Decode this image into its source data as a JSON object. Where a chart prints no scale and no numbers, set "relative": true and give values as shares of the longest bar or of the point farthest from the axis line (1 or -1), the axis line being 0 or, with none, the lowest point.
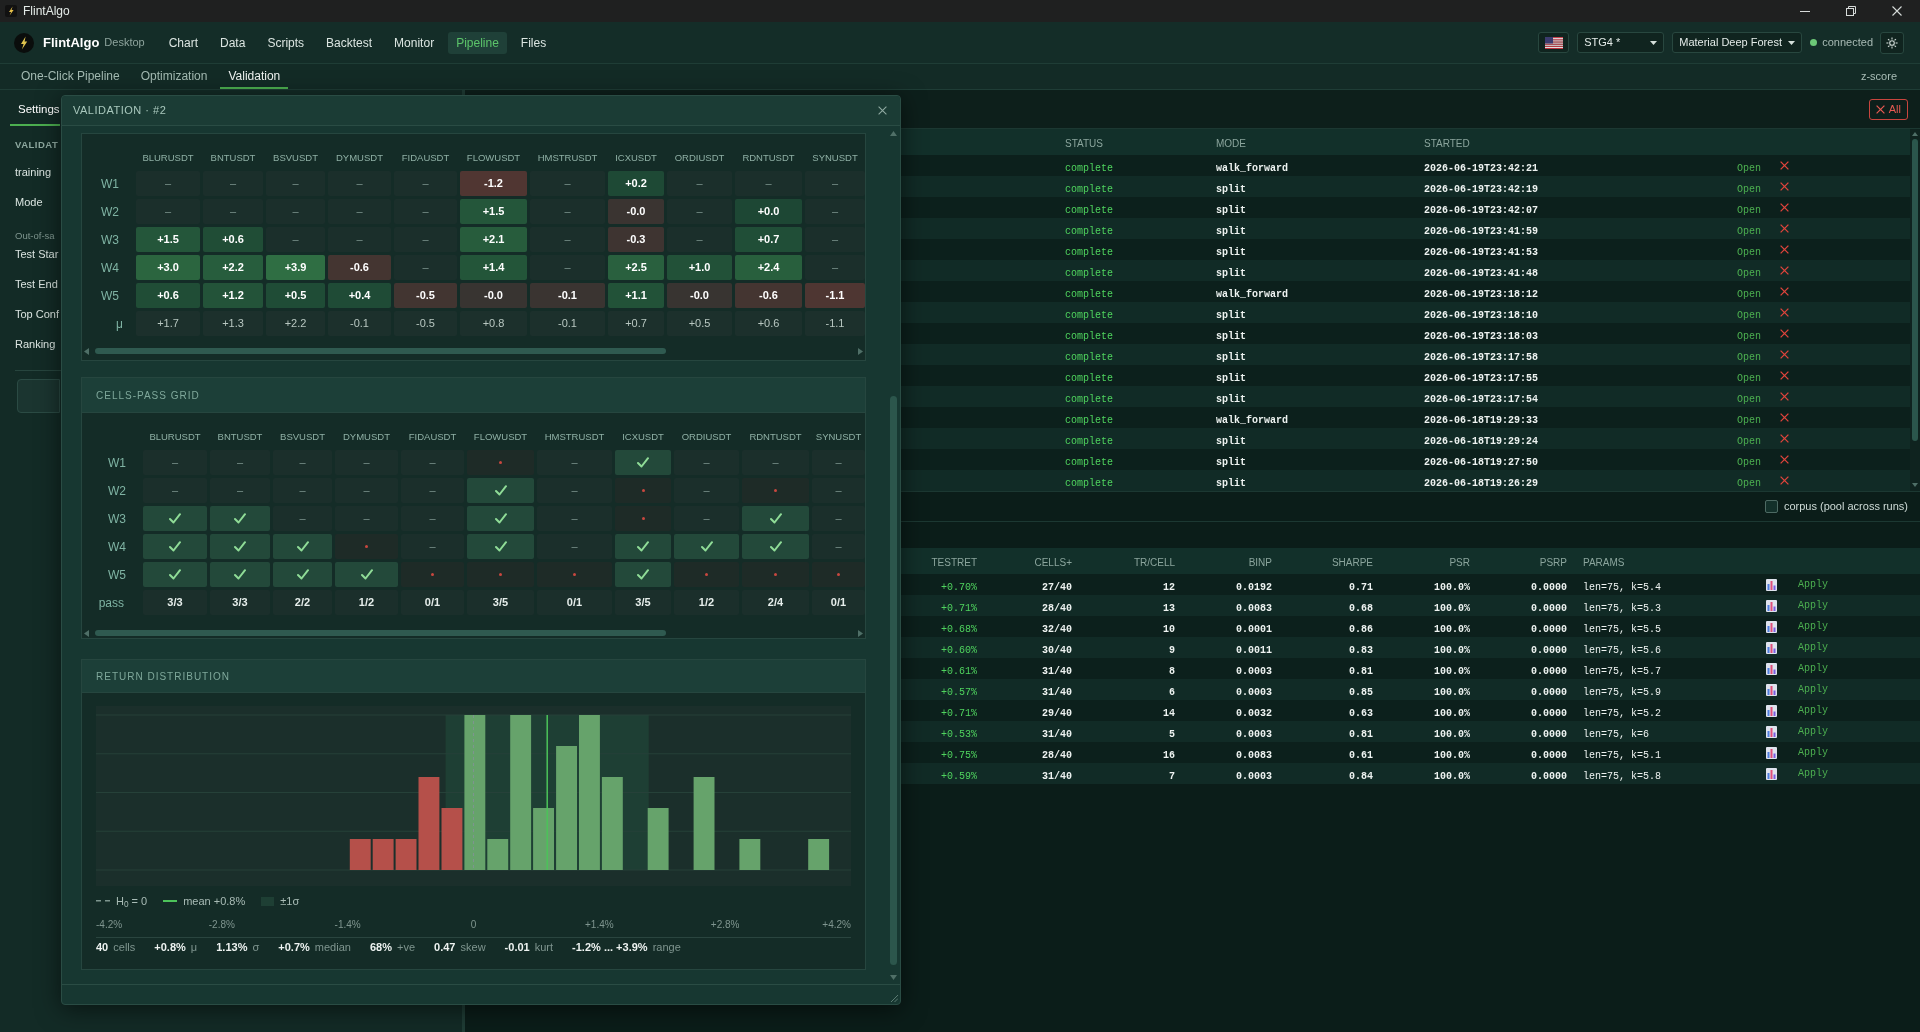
{
  "window": {
    "title": "FlintAlgo"
  },
  "nav": {
    "brand": "FlintAlgo",
    "edition": "Desktop",
    "items": [
      {
        "label": "Chart",
        "selected": false
      },
      {
        "label": "Data",
        "selected": false
      },
      {
        "label": "Scripts",
        "selected": false
      },
      {
        "label": "Backtest",
        "selected": false
      },
      {
        "label": "Monitor",
        "selected": false
      },
      {
        "label": "Pipeline",
        "selected": true
      },
      {
        "label": "Files",
        "selected": false
      }
    ],
    "strategy": "STG4 *",
    "theme": "Material Deep Forest",
    "connection": {
      "label": "connected",
      "on": true
    }
  },
  "subtabs": {
    "items": [
      {
        "label": "One-Click Pipeline",
        "selected": false
      },
      {
        "label": "Optimization",
        "selected": false
      },
      {
        "label": "Validation",
        "selected": true
      }
    ],
    "score_mode": "z-score"
  },
  "settings_panel": {
    "tabs": [
      {
        "label": "Settings",
        "selected": true
      }
    ],
    "items": [
      {
        "kind": "heading",
        "text": "VALIDAT"
      },
      {
        "kind": "label",
        "text": "training"
      },
      {
        "kind": "label",
        "text": "Mode"
      },
      {
        "kind": "note",
        "text": "Out-of-sa"
      },
      {
        "kind": "label",
        "text": "Test Star"
      },
      {
        "kind": "label",
        "text": "Test End"
      },
      {
        "kind": "label",
        "text": "Top Conf"
      },
      {
        "kind": "label",
        "text": "Ranking"
      }
    ]
  },
  "runs": {
    "clear_all": "All",
    "columns": [
      "STATUS",
      "MODE",
      "STARTED"
    ],
    "rows": [
      {
        "status": "complete",
        "mode": "walk_forward",
        "started": "2026-06-19T23:42:21",
        "action": "Open"
      },
      {
        "status": "complete",
        "mode": "split",
        "started": "2026-06-19T23:42:19",
        "action": "Open"
      },
      {
        "status": "complete",
        "mode": "split",
        "started": "2026-06-19T23:42:07",
        "action": "Open"
      },
      {
        "status": "complete",
        "mode": "split",
        "started": "2026-06-19T23:41:59",
        "action": "Open"
      },
      {
        "status": "complete",
        "mode": "split",
        "started": "2026-06-19T23:41:53",
        "action": "Open"
      },
      {
        "status": "complete",
        "mode": "split",
        "started": "2026-06-19T23:41:48",
        "action": "Open"
      },
      {
        "status": "complete",
        "mode": "walk_forward",
        "started": "2026-06-19T23:18:12",
        "action": "Open"
      },
      {
        "status": "complete",
        "mode": "split",
        "started": "2026-06-19T23:18:10",
        "action": "Open"
      },
      {
        "status": "complete",
        "mode": "split",
        "started": "2026-06-19T23:18:03",
        "action": "Open"
      },
      {
        "status": "complete",
        "mode": "split",
        "started": "2026-06-19T23:17:58",
        "action": "Open"
      },
      {
        "status": "complete",
        "mode": "split",
        "started": "2026-06-19T23:17:55",
        "action": "Open"
      },
      {
        "status": "complete",
        "mode": "split",
        "started": "2026-06-19T23:17:54",
        "action": "Open"
      },
      {
        "status": "complete",
        "mode": "walk_forward",
        "started": "2026-06-18T19:29:33",
        "action": "Open"
      },
      {
        "status": "complete",
        "mode": "split",
        "started": "2026-06-18T19:29:24",
        "action": "Open"
      },
      {
        "status": "complete",
        "mode": "split",
        "started": "2026-06-18T19:27:50",
        "action": "Open"
      },
      {
        "status": "complete",
        "mode": "split",
        "started": "2026-06-18T19:26:29",
        "action": "Open"
      }
    ]
  },
  "corpus": {
    "label": "corpus (pool across runs)",
    "checked": false
  },
  "results": {
    "columns": [
      "TESTRET",
      "CELLS+",
      "TR/CELL",
      "BINP",
      "SHARPE",
      "PSR",
      "PSRP",
      "PARAMS"
    ],
    "rows": [
      {
        "cells": [
          "+0.70%",
          "27/40",
          "12",
          "0.0192",
          "0.71",
          "100.0%",
          "0.0000",
          "len=75, k=5.4"
        ],
        "action": "Apply"
      },
      {
        "cells": [
          "+0.71%",
          "28/40",
          "13",
          "0.0083",
          "0.68",
          "100.0%",
          "0.0000",
          "len=75, k=5.3"
        ],
        "action": "Apply"
      },
      {
        "cells": [
          "+0.68%",
          "32/40",
          "10",
          "0.0001",
          "0.86",
          "100.0%",
          "0.0000",
          "len=75, k=5.5"
        ],
        "action": "Apply"
      },
      {
        "cells": [
          "+0.60%",
          "30/40",
          "9",
          "0.0011",
          "0.83",
          "100.0%",
          "0.0000",
          "len=75, k=5.6"
        ],
        "action": "Apply"
      },
      {
        "cells": [
          "+0.61%",
          "31/40",
          "8",
          "0.0003",
          "0.81",
          "100.0%",
          "0.0000",
          "len=75, k=5.7"
        ],
        "action": "Apply"
      },
      {
        "cells": [
          "+0.57%",
          "31/40",
          "6",
          "0.0003",
          "0.85",
          "100.0%",
          "0.0000",
          "len=75, k=5.9"
        ],
        "action": "Apply"
      },
      {
        "cells": [
          "+0.71%",
          "29/40",
          "14",
          "0.0032",
          "0.63",
          "100.0%",
          "0.0000",
          "len=75, k=5.2"
        ],
        "action": "Apply"
      },
      {
        "cells": [
          "+0.53%",
          "31/40",
          "5",
          "0.0003",
          "0.81",
          "100.0%",
          "0.0000",
          "len=75, k=6"
        ],
        "action": "Apply"
      },
      {
        "cells": [
          "+0.75%",
          "28/40",
          "16",
          "0.0083",
          "0.61",
          "100.0%",
          "0.0000",
          "len=75, k=5.1"
        ],
        "action": "Apply"
      },
      {
        "cells": [
          "+0.59%",
          "31/40",
          "7",
          "0.0003",
          "0.84",
          "100.0%",
          "0.0000",
          "len=75, k=5.8"
        ],
        "action": "Apply"
      }
    ]
  },
  "validation_modal": {
    "title": "VALIDATION · #2",
    "score_grid": {
      "columns": [
        "BLURUSDT",
        "BNTUSDT",
        "BSVUSDT",
        "DYMUSDT",
        "FIDAUSDT",
        "FLOWUSDT",
        "HMSTRUSDT",
        "ICXUSDT",
        "ORDIUSDT",
        "RDNTUSDT",
        "SYNUSDT"
      ],
      "rows": [
        {
          "label": "W1",
          "cells": [
            {
              "text": "–"
            },
            {
              "text": "–"
            },
            {
              "text": "–"
            },
            {
              "text": "–"
            },
            {
              "text": "–"
            },
            {
              "text": "-1.2",
              "color": "#503632"
            },
            {
              "text": "–"
            },
            {
              "text": "+0.2",
              "color": "#1e4935"
            },
            {
              "text": "–"
            },
            {
              "text": "–"
            },
            {
              "text": "–"
            }
          ]
        },
        {
          "label": "W2",
          "cells": [
            {
              "text": "–"
            },
            {
              "text": "–"
            },
            {
              "text": "–"
            },
            {
              "text": "–"
            },
            {
              "text": "–"
            },
            {
              "text": "+1.5",
              "color": "#24563a"
            },
            {
              "text": "–"
            },
            {
              "text": "-0.0",
              "color": "#3a3431"
            },
            {
              "text": "–"
            },
            {
              "text": "+0.0",
              "color": "#1d4734"
            },
            {
              "text": "–"
            }
          ]
        },
        {
          "label": "W3",
          "cells": [
            {
              "text": "+1.5",
              "color": "#24563a"
            },
            {
              "text": "+0.6",
              "color": "#204d36"
            },
            {
              "text": "–"
            },
            {
              "text": "–"
            },
            {
              "text": "–"
            },
            {
              "text": "+2.1",
              "color": "#275c3c"
            },
            {
              "text": "–"
            },
            {
              "text": "-0.3",
              "color": "#3e3431"
            },
            {
              "text": "–"
            },
            {
              "text": "+0.7",
              "color": "#204e37"
            },
            {
              "text": "–"
            }
          ]
        },
        {
          "label": "W4",
          "cells": [
            {
              "text": "+3.0",
              "color": "#2b653f"
            },
            {
              "text": "+2.2",
              "color": "#275d3d"
            },
            {
              "text": "+3.9",
              "color": "#2f6e43"
            },
            {
              "text": "-0.6",
              "color": "#443531"
            },
            {
              "text": "–"
            },
            {
              "text": "+1.4",
              "color": "#235539"
            },
            {
              "text": "–"
            },
            {
              "text": "+2.5",
              "color": "#29603e"
            },
            {
              "text": "+1.0",
              "color": "#225138"
            },
            {
              "text": "+2.4",
              "color": "#285f3d"
            },
            {
              "text": "–"
            }
          ]
        },
        {
          "label": "W5",
          "cells": [
            {
              "text": "+0.6",
              "color": "#204d36"
            },
            {
              "text": "+1.2",
              "color": "#235339"
            },
            {
              "text": "+0.5",
              "color": "#1f4c36"
            },
            {
              "text": "+0.4",
              "color": "#1f4b36"
            },
            {
              "text": "-0.5",
              "color": "#423531"
            },
            {
              "text": "-0.0",
              "color": "#383431"
            },
            {
              "text": "-0.1",
              "color": "#3a3431"
            },
            {
              "text": "+1.1",
              "color": "#225238"
            },
            {
              "text": "-0.0",
              "color": "#383431"
            },
            {
              "text": "-0.6",
              "color": "#443531"
            },
            {
              "text": "-1.1",
              "color": "#4e3632"
            }
          ]
        }
      ],
      "mean_row": {
        "label": "μ",
        "cells": [
          "+1.7",
          "+1.3",
          "+2.2",
          "-0.1",
          "-0.5",
          "+0.8",
          "-0.1",
          "+0.7",
          "+0.5",
          "+0.6",
          "-1.1"
        ]
      }
    },
    "pass_grid": {
      "title": "CELLS-PASS GRID",
      "columns": [
        "BLURUSDT",
        "BNTUSDT",
        "BSVUSDT",
        "DYMUSDT",
        "FIDAUSDT",
        "FLOWUSDT",
        "HMSTRUSDT",
        "ICXUSDT",
        "ORDIUSDT",
        "RDNTUSDT",
        "SYNUSDT"
      ],
      "rows": [
        {
          "label": "W1",
          "cells": [
            {
              "kind": "empty",
              "text": "–"
            },
            {
              "kind": "empty",
              "text": "–"
            },
            {
              "kind": "empty",
              "text": "–"
            },
            {
              "kind": "empty",
              "text": "–"
            },
            {
              "kind": "empty",
              "text": "–"
            },
            {
              "kind": "fail"
            },
            {
              "kind": "empty",
              "text": "–"
            },
            {
              "kind": "pass"
            },
            {
              "kind": "empty",
              "text": "–"
            },
            {
              "kind": "empty",
              "text": "–"
            },
            {
              "kind": "empty",
              "text": "–"
            }
          ]
        },
        {
          "label": "W2",
          "cells": [
            {
              "kind": "empty",
              "text": "–"
            },
            {
              "kind": "empty",
              "text": "–"
            },
            {
              "kind": "empty",
              "text": "–"
            },
            {
              "kind": "empty",
              "text": "–"
            },
            {
              "kind": "empty",
              "text": "–"
            },
            {
              "kind": "pass"
            },
            {
              "kind": "empty",
              "text": "–"
            },
            {
              "kind": "fail"
            },
            {
              "kind": "empty",
              "text": "–"
            },
            {
              "kind": "fail"
            },
            {
              "kind": "empty",
              "text": "–"
            }
          ]
        },
        {
          "label": "W3",
          "cells": [
            {
              "kind": "pass"
            },
            {
              "kind": "pass"
            },
            {
              "kind": "empty",
              "text": "–"
            },
            {
              "kind": "empty",
              "text": "–"
            },
            {
              "kind": "empty",
              "text": "–"
            },
            {
              "kind": "pass"
            },
            {
              "kind": "empty",
              "text": "–"
            },
            {
              "kind": "fail"
            },
            {
              "kind": "empty",
              "text": "–"
            },
            {
              "kind": "pass"
            },
            {
              "kind": "empty",
              "text": "–"
            }
          ]
        },
        {
          "label": "W4",
          "cells": [
            {
              "kind": "pass"
            },
            {
              "kind": "pass"
            },
            {
              "kind": "pass"
            },
            {
              "kind": "fail"
            },
            {
              "kind": "empty",
              "text": "–"
            },
            {
              "kind": "pass"
            },
            {
              "kind": "empty",
              "text": "–"
            },
            {
              "kind": "pass"
            },
            {
              "kind": "pass"
            },
            {
              "kind": "pass"
            },
            {
              "kind": "empty",
              "text": "–"
            }
          ]
        },
        {
          "label": "W5",
          "cells": [
            {
              "kind": "pass"
            },
            {
              "kind": "pass"
            },
            {
              "kind": "pass"
            },
            {
              "kind": "pass"
            },
            {
              "kind": "fail"
            },
            {
              "kind": "fail"
            },
            {
              "kind": "fail"
            },
            {
              "kind": "pass"
            },
            {
              "kind": "fail"
            },
            {
              "kind": "fail"
            },
            {
              "kind": "fail"
            }
          ]
        }
      ],
      "summary_row": {
        "label": "pass",
        "cells": [
          "3/3",
          "3/3",
          "2/2",
          "1/2",
          "0/1",
          "3/5",
          "0/1",
          "3/5",
          "1/2",
          "2/4",
          "0/1"
        ]
      }
    },
    "distribution": {
      "title": "RETURN DISTRIBUTION",
      "chart_data": {
        "type": "bar",
        "relative": true,
        "x": [
          -1.26,
          -1.005,
          -0.75,
          -0.495,
          -0.24,
          0.015,
          0.27,
          0.525,
          0.78,
          1.035,
          1.29,
          1.545,
          1.8,
          2.055,
          2.31,
          2.565,
          2.82,
          3.075,
          3.33,
          3.585,
          3.84
        ],
        "series": [
          {
            "color": "#b5504a",
            "values": [
              0.2,
              0.2,
              0.2,
              0.6,
              0.4,
              0,
              0,
              0,
              0,
              0,
              0,
              0,
              0,
              0,
              0,
              0,
              0,
              0,
              0,
              0,
              0
            ]
          },
          {
            "color": "#66a36b",
            "values": [
              0,
              0,
              0,
              0,
              0,
              1,
              0.2,
              1,
              0.4,
              0.8,
              1,
              0.6,
              0,
              0.4,
              0,
              0.6,
              0,
              0.2,
              0,
              0,
              0.2
            ]
          }
        ],
        "stacked": true,
        "xlim": [
          -4.2,
          4.2
        ],
        "xticks": [
          {
            "value": -4.2,
            "label": "-4.2%"
          },
          {
            "value": -2.8,
            "label": "-2.8%"
          },
          {
            "value": -1.4,
            "label": "-1.4%"
          },
          {
            "value": 0,
            "label": "0"
          },
          {
            "value": 1.4,
            "label": "+1.4%"
          },
          {
            "value": 2.8,
            "label": "+2.8%"
          },
          {
            "value": 4.2,
            "label": "+4.2%"
          }
        ],
        "ref_lines": [
          {
            "axis": "x",
            "value": 0
          },
          {
            "axis": "x",
            "value": 0.82
          }
        ],
        "bands": [
          {
            "axis": "x",
            "from": -0.31,
            "to": 1.95
          }
        ]
      },
      "legend": [
        {
          "kind": "dashed",
          "label": "H$_{0}$ = 0"
        },
        {
          "kind": "line",
          "label": "mean +0.8%"
        },
        {
          "kind": "band",
          "label": "±1σ"
        }
      ],
      "stats": [
        "**40** cells",
        "**+0.8%** μ",
        "**1.13%** σ",
        "**+0.7%** median",
        "**68%** +ve",
        "**0.47** skew",
        "**-0.01** kurt",
        "**-1.2% ... +3.9%** range"
      ]
    }
  }
}
